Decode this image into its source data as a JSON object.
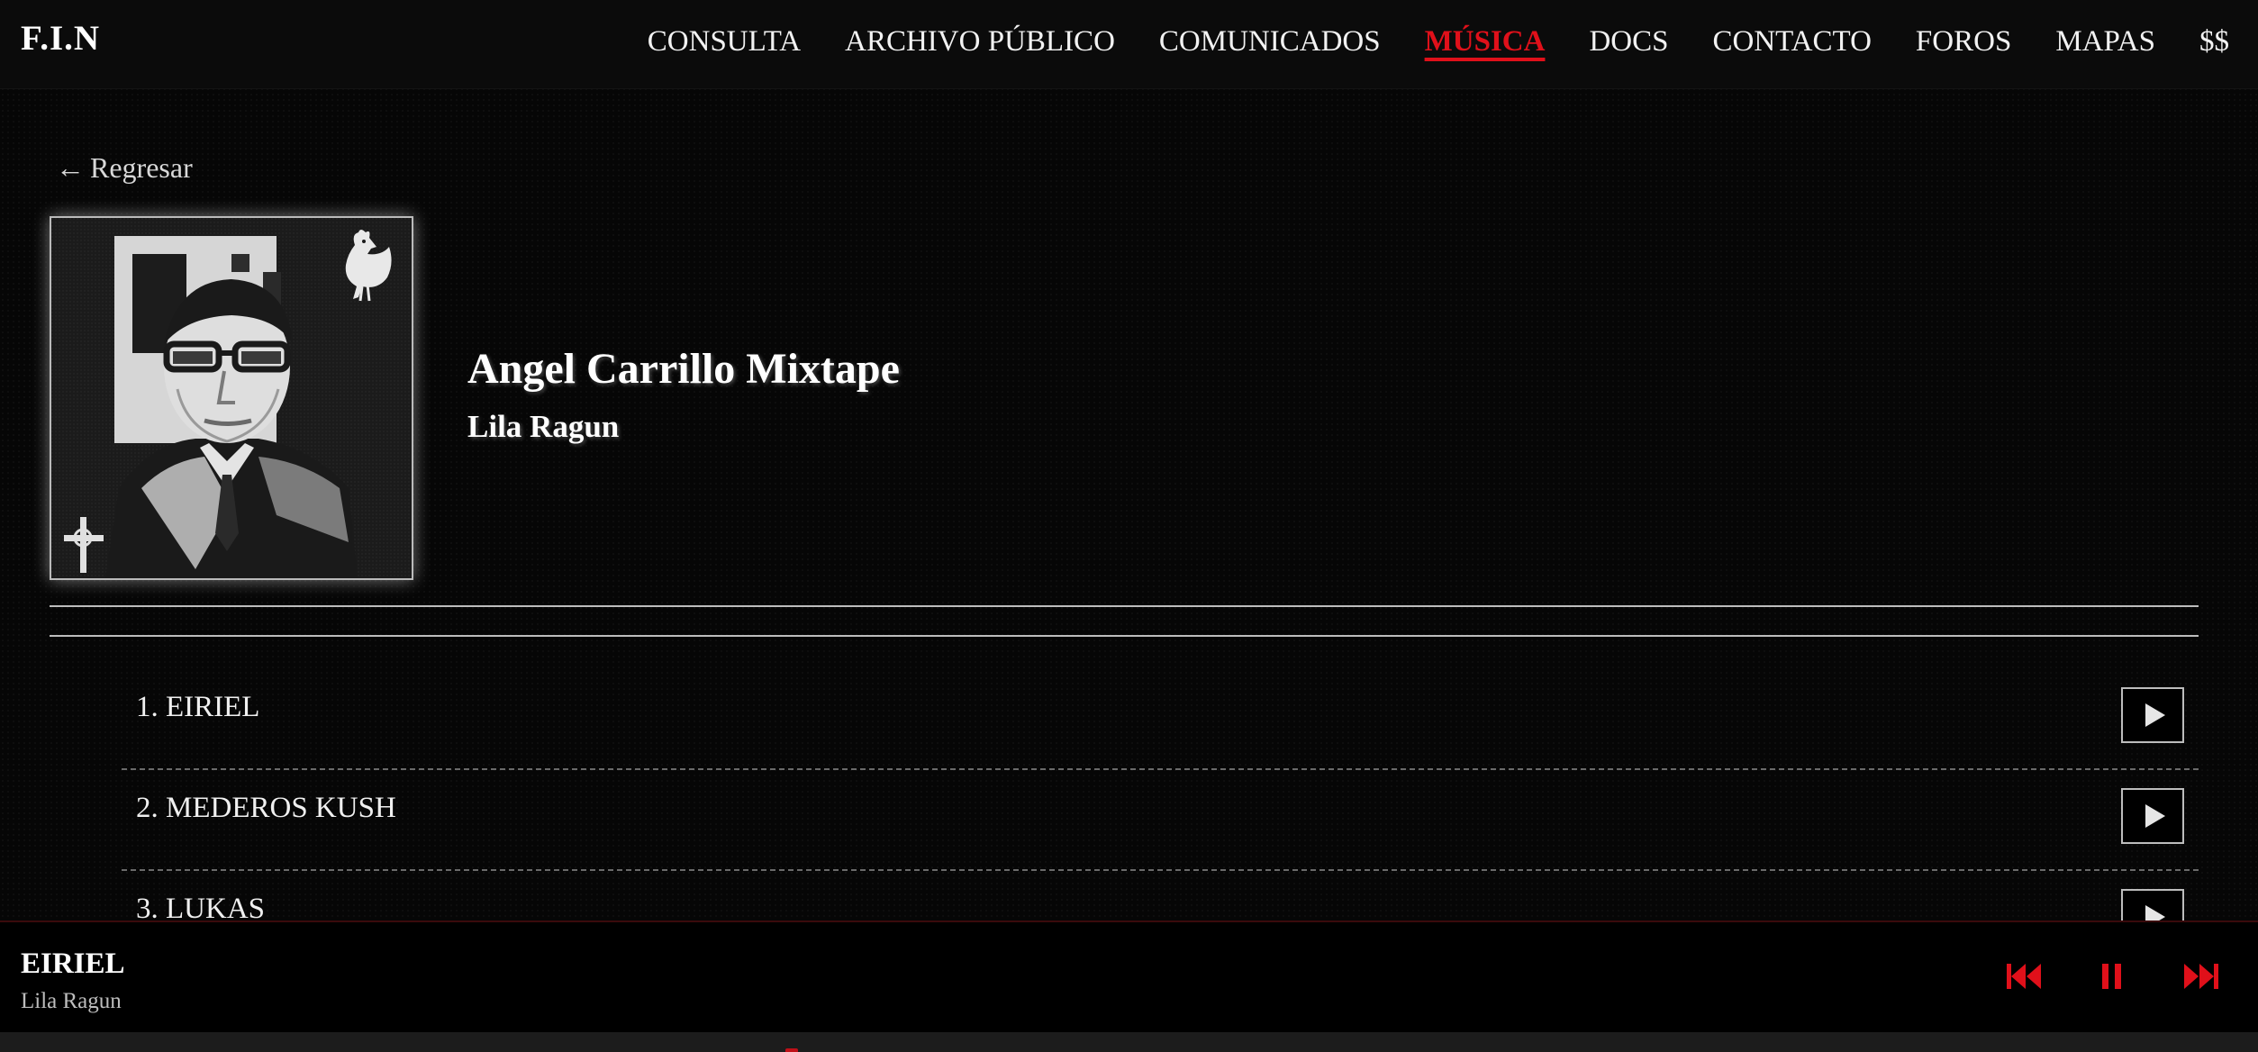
{
  "brand": "F.I.N",
  "nav": [
    {
      "label": "CONSULTA"
    },
    {
      "label": "ARCHIVO PÚBLICO"
    },
    {
      "label": "COMUNICADOS"
    },
    {
      "label": "MÚSICA",
      "active": true
    },
    {
      "label": "DOCS"
    },
    {
      "label": "CONTACTO"
    },
    {
      "label": "FOROS"
    },
    {
      "label": "MAPAS"
    },
    {
      "label": "$$"
    }
  ],
  "back": {
    "arrow": "←",
    "label": "Regresar"
  },
  "album": {
    "title": "Angel Carrillo Mixtape",
    "artist": "Lila Ragun",
    "cover_icons": [
      "rooster-icon",
      "cross-icon"
    ]
  },
  "tracks": [
    {
      "label": "1. EIRIEL"
    },
    {
      "label": "2. MEDEROS KUSH"
    },
    {
      "label": "3. LUKAS"
    }
  ],
  "player": {
    "title": "EIRIEL",
    "artist": "Lila Ragun",
    "state": "playing"
  },
  "colors": {
    "accent": "#e0101a",
    "background": "#060606",
    "text": "#f0f0f0"
  }
}
